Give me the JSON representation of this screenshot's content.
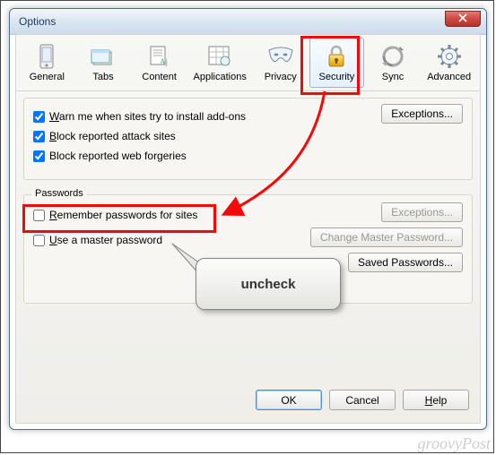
{
  "window": {
    "title": "Options"
  },
  "tabs": {
    "general": "General",
    "tabs": "Tabs",
    "content": "Content",
    "applications": "Applications",
    "privacy": "Privacy",
    "security": "Security",
    "sync": "Sync",
    "advanced": "Advanced"
  },
  "colors": {
    "accent": "#f30909",
    "link": "#1b3a5e"
  },
  "top_group": {
    "warn_addons": {
      "checked": true,
      "label_pre": "W",
      "label_rest": "arn me when sites try to install add-ons"
    },
    "block_attack": {
      "checked": true,
      "label_pre": "B",
      "label_rest": "lock reported attack sites"
    },
    "block_forgeries": {
      "checked": true,
      "label_rest": "Block reported web forgeries"
    },
    "exceptions_btn": "Exceptions..."
  },
  "passwords": {
    "label": "Passwords",
    "remember": {
      "checked": false,
      "label_pre": "R",
      "label_rest": "emember passwords for sites"
    },
    "master": {
      "checked": false,
      "label_pre": "U",
      "label_rest": "se a master password"
    },
    "exceptions_btn": "Exceptions...",
    "change_master_btn": "Change Master Password...",
    "saved_btn": "Saved Passwords..."
  },
  "footer": {
    "ok": "OK",
    "cancel": "Cancel",
    "help": "Help"
  },
  "annotation": {
    "callout": "uncheck"
  },
  "watermark": "groovyPost"
}
